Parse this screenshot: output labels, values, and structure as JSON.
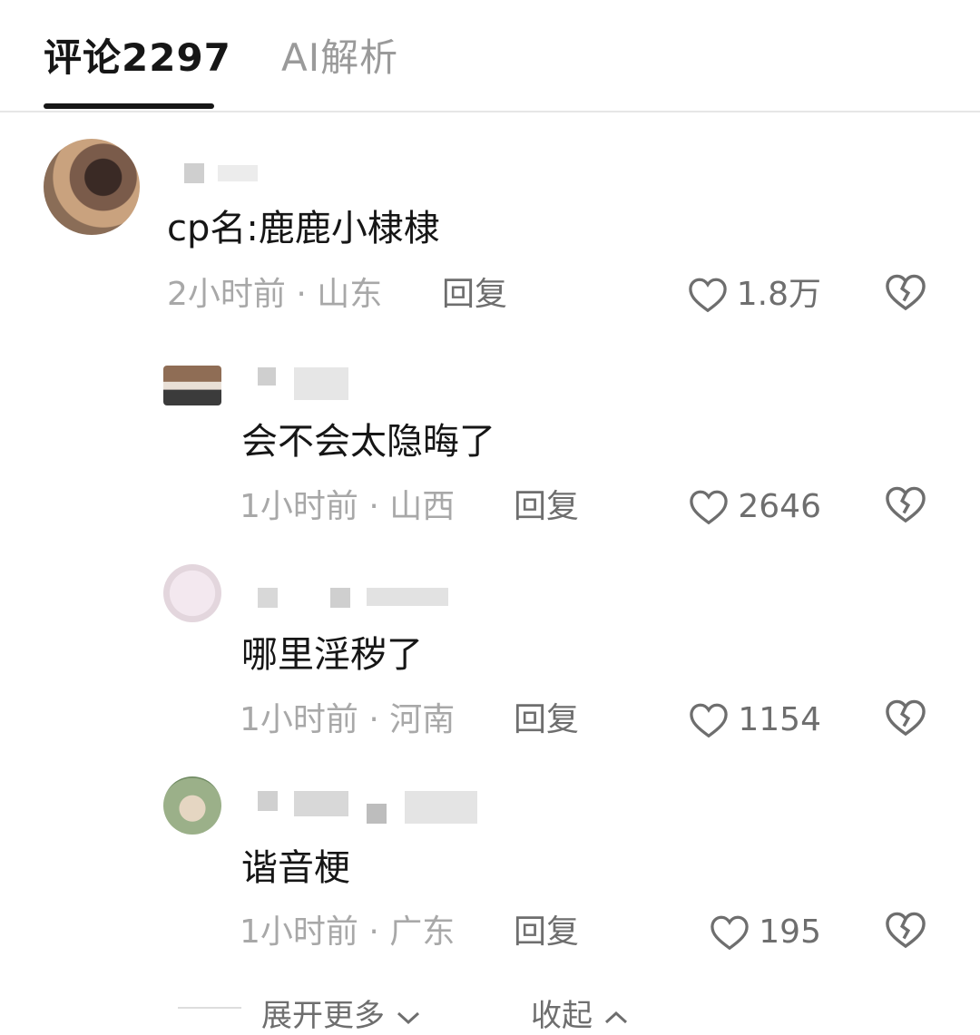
{
  "tabs": {
    "comments_label": "评论2297",
    "ai_label": "AI解析"
  },
  "comments": [
    {
      "content": "cp名:鹿鹿小棣棣",
      "time": "2小时前",
      "location": "山东",
      "reply_label": "回复",
      "likes": "1.8万"
    },
    {
      "content": "会不会太隐晦了",
      "time": "1小时前",
      "location": "山西",
      "reply_label": "回复",
      "likes": "2646"
    },
    {
      "content": "哪里淫秽了",
      "time": "1小时前",
      "location": "河南",
      "reply_label": "回复",
      "likes": "1154"
    },
    {
      "content": "谐音梗",
      "time": "1小时前",
      "location": "广东",
      "reply_label": "回复",
      "likes": "195"
    }
  ],
  "footer": {
    "expand_label": "展开更多",
    "collapse_label": "收起"
  },
  "icons": {
    "like": "heart-outline-icon",
    "dislike": "broken-heart-icon",
    "expand": "chevron-down-icon",
    "collapse": "chevron-up-icon"
  }
}
